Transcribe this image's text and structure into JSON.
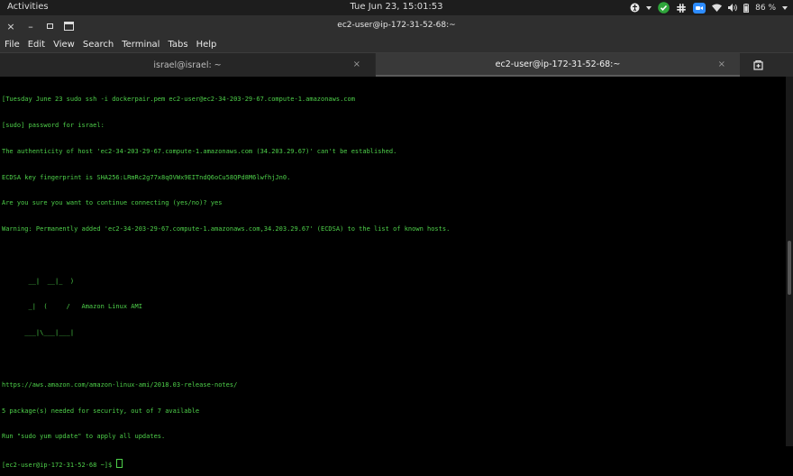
{
  "topbar": {
    "activities": "Activities",
    "clock": "Tue Jun 23, 15:01:53",
    "battery": "86 %",
    "colors": {
      "check": "#2fa53b",
      "zoom": "#2d8cff"
    }
  },
  "window": {
    "title": "ec2-user@ip-172-31-52-68:~",
    "close_glyph": "×",
    "minimize_glyph": "–",
    "maximize_glyph": "▫"
  },
  "menu": [
    "File",
    "Edit",
    "View",
    "Search",
    "Terminal",
    "Tabs",
    "Help"
  ],
  "tabs": [
    {
      "label": "israel@israel: ~",
      "close": "×"
    },
    {
      "label": "ec2-user@ip-172-31-52-68:~",
      "close": "×"
    }
  ],
  "terminal": {
    "lines": [
      "[Tuesday June 23 sudo ssh -i dockerpair.pem ec2-user@ec2-34-203-29-67.compute-1.amazonaws.com",
      "[sudo] password for israel:",
      "The authenticity of host 'ec2-34-203-29-67.compute-1.amazonaws.com (34.203.29.67)' can't be established.",
      "ECDSA key fingerprint is SHA256:LRmRc2g77x8qOVWx9EITndQ6oCu58QPd8M6lwfhjJn0.",
      "Are you sure you want to continue connecting (yes/no)? yes",
      "Warning: Permanently added 'ec2-34-203-29-67.compute-1.amazonaws.com,34.203.29.67' (ECDSA) to the list of known hosts.",
      "",
      "       __|  __|_  )",
      "       _|  (     /   Amazon Linux AMI",
      "      ___|\\___|___|",
      "",
      "https://aws.amazon.com/amazon-linux-ami/2018.03-release-notes/",
      "5 package(s) needed for security, out of 7 available",
      "Run \"sudo yum update\" to apply all updates."
    ],
    "prompt": "[ec2-user@ip-172-31-52-68 ~]$ ",
    "text_color": "#4ed04a"
  }
}
